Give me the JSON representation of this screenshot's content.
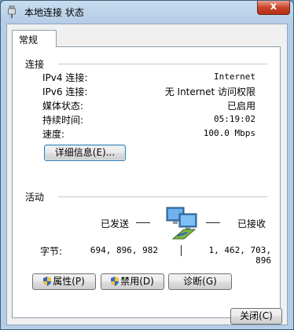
{
  "window": {
    "title": "本地连接 状态",
    "close_label": "x"
  },
  "tabs": [
    {
      "label": "常规"
    }
  ],
  "connection": {
    "heading": "连接",
    "rows": [
      {
        "label": "IPv4 连接:",
        "value": "Internet"
      },
      {
        "label": "IPv6 连接:",
        "value": "无 Internet 访问权限"
      },
      {
        "label": "媒体状态:",
        "value": "已启用"
      },
      {
        "label": "持续时间:",
        "value": "05:19:02"
      },
      {
        "label": "速度:",
        "value": "100.0 Mbps"
      }
    ],
    "details_button": "详细信息(E)..."
  },
  "activity": {
    "heading": "活动",
    "sent_label": "已发送",
    "received_label": "已接收",
    "bytes_label": "字节:",
    "bytes_sent": "694, 896, 982",
    "bytes_received": "1, 462, 703, 896"
  },
  "buttons": {
    "properties": "属性(P)",
    "disable": "禁用(D)",
    "diagnose": "诊断(G)",
    "close": "关闭(C)"
  },
  "icons": {
    "title": "network-connection-icon",
    "activity": "network-activity-icon",
    "shield": "uac-shield-icon"
  }
}
